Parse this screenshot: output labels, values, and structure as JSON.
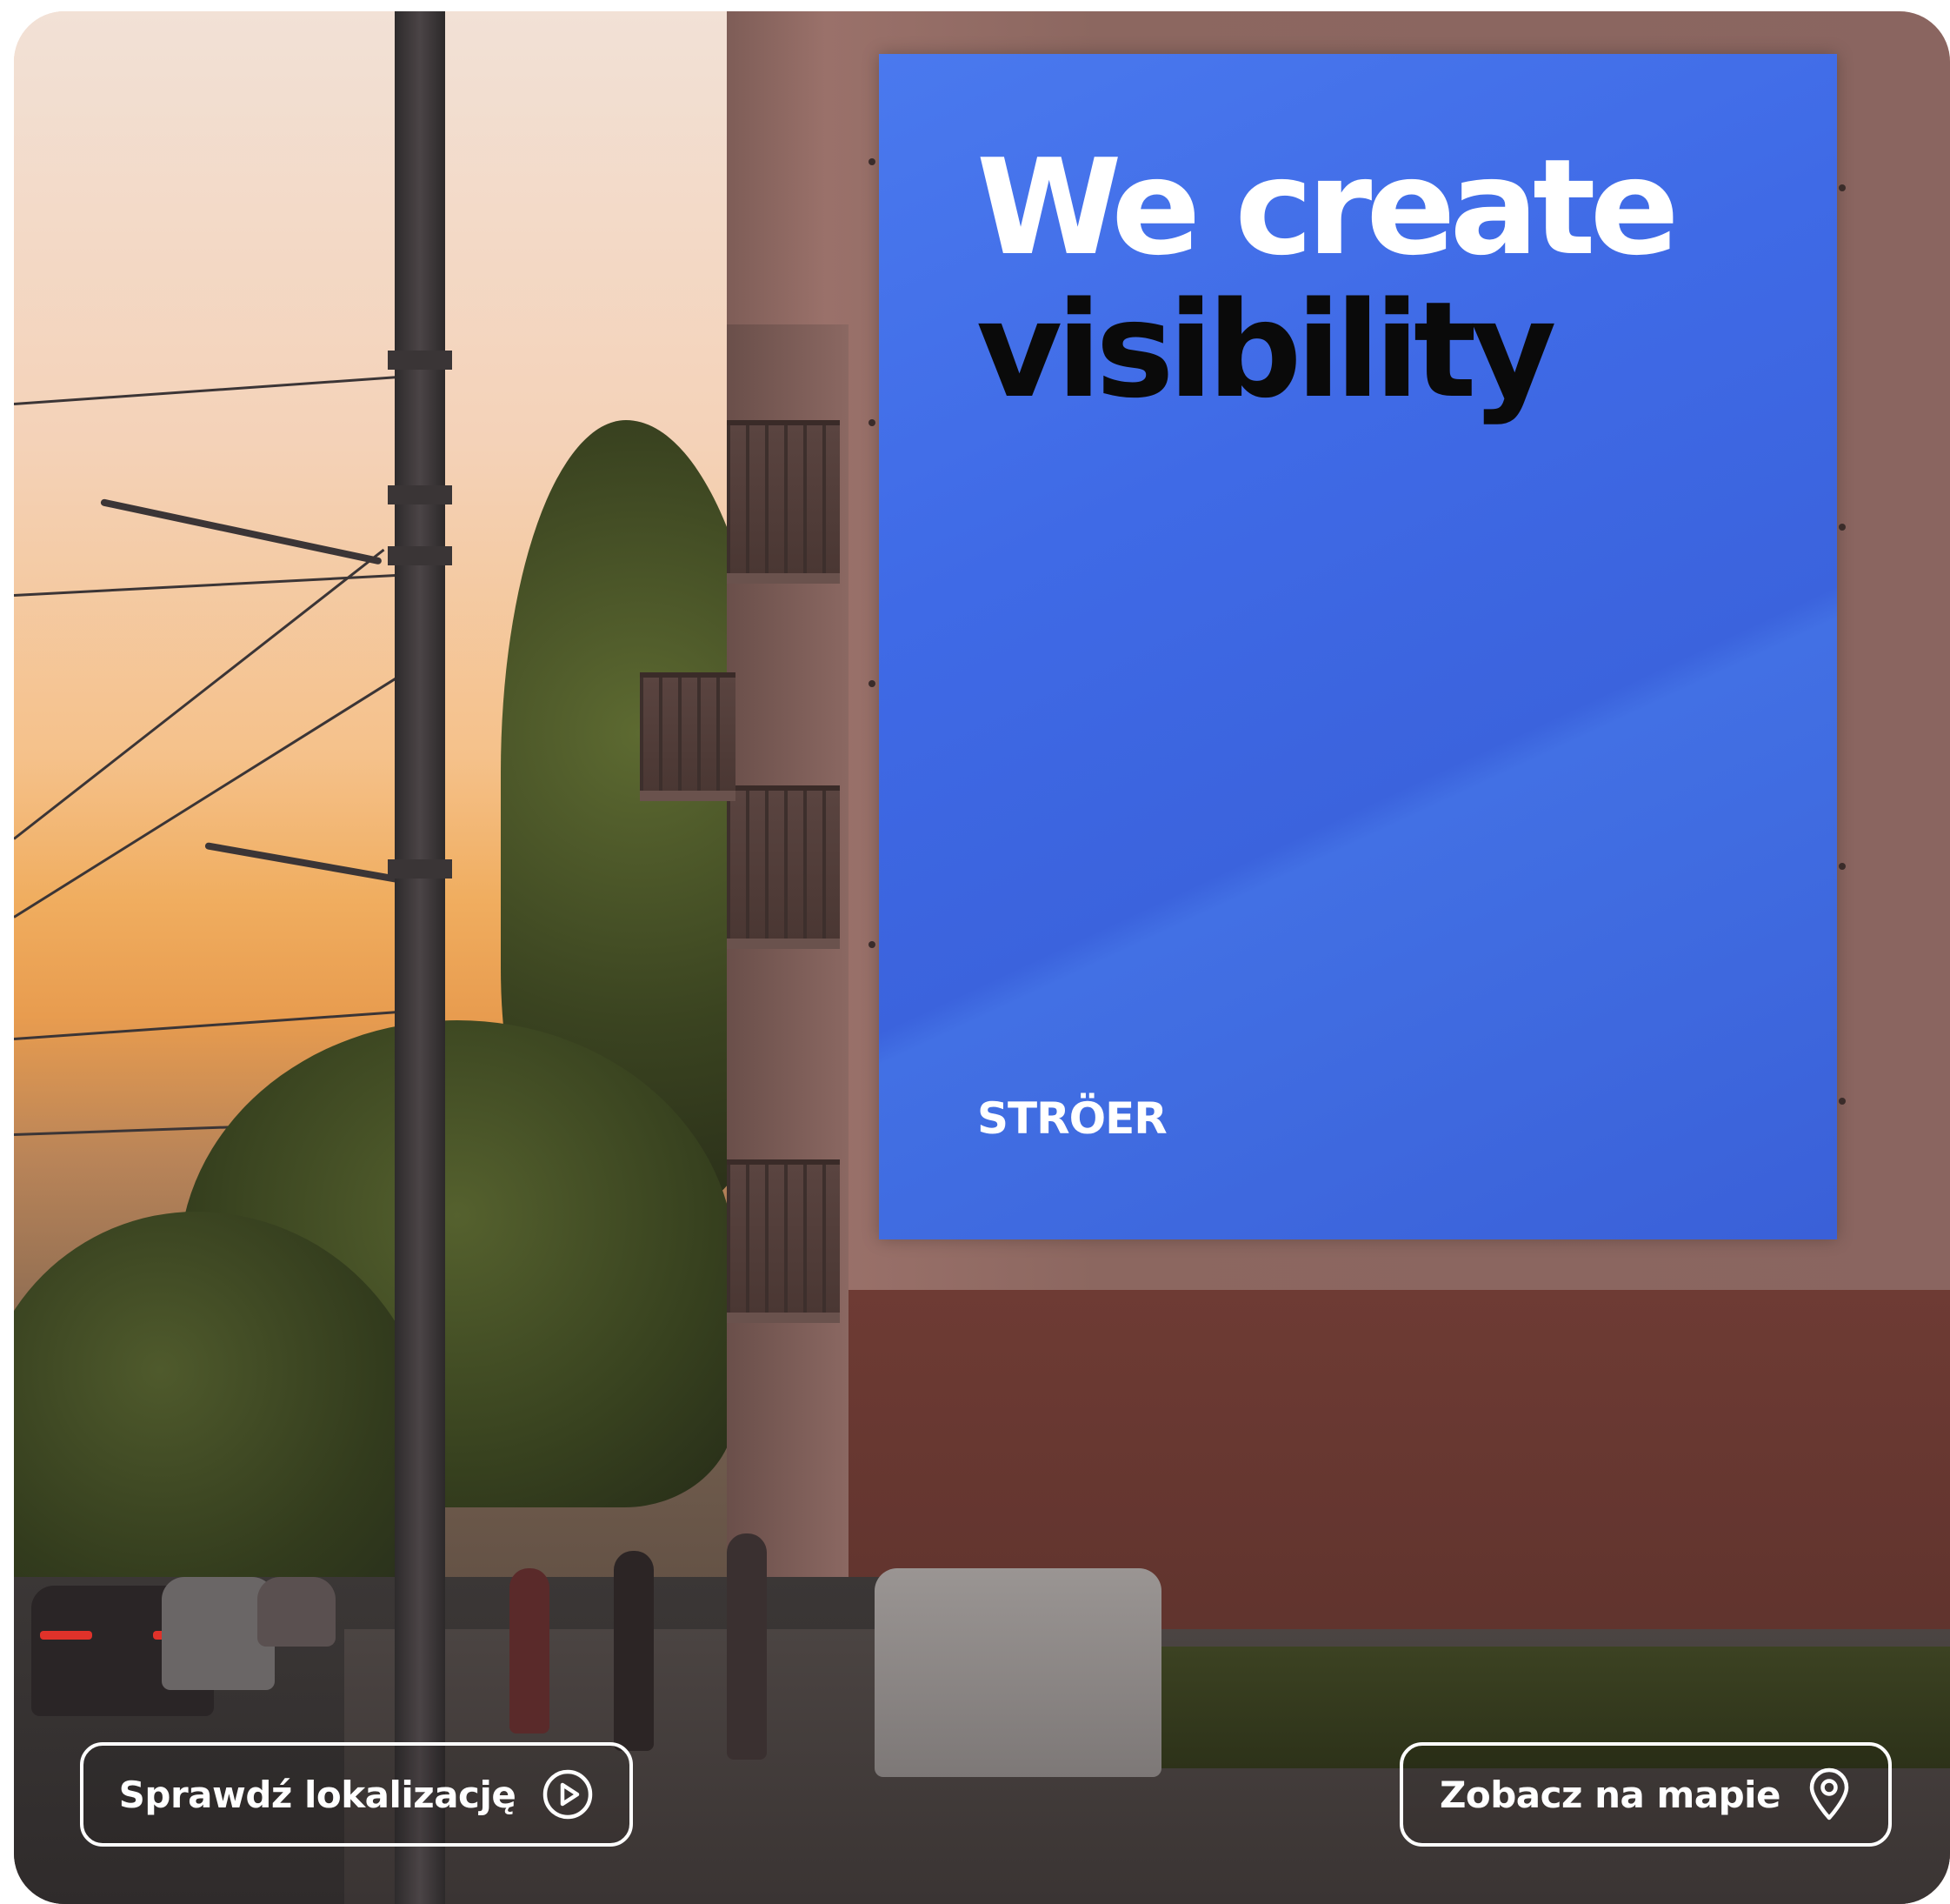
{
  "billboard": {
    "headline_line1": "We create",
    "headline_line2": "visibility",
    "brand_logo": "STRÖER",
    "background_color": "#3f6ae6"
  },
  "actions": {
    "check_location_label": "Sprawdź lokalizację",
    "check_location_icon": "play-circle-icon",
    "view_on_map_label": "Zobacz na mapie",
    "view_on_map_icon": "map-pin-icon"
  }
}
